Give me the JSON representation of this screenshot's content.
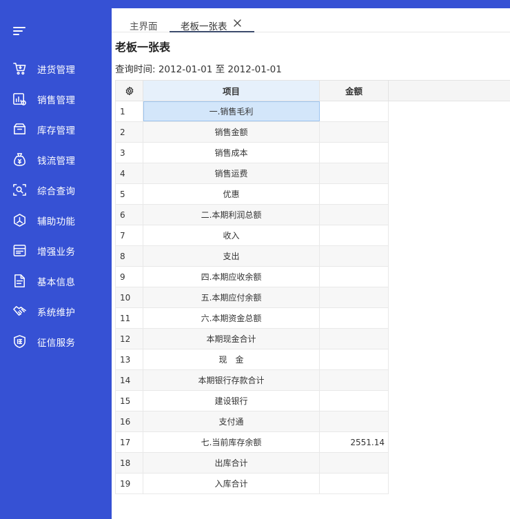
{
  "sidebar": {
    "items": [
      {
        "label": "进货管理",
        "icon": "cart-icon"
      },
      {
        "label": "销售管理",
        "icon": "sales-chart-icon"
      },
      {
        "label": "库存管理",
        "icon": "box-icon"
      },
      {
        "label": "钱流管理",
        "icon": "money-bag-icon"
      },
      {
        "label": "综合查询",
        "icon": "scan-search-icon"
      },
      {
        "label": "辅助功能",
        "icon": "hexagon-tool-icon"
      },
      {
        "label": "增强业务",
        "icon": "list-doc-icon"
      },
      {
        "label": "基本信息",
        "icon": "document-icon"
      },
      {
        "label": "系统维护",
        "icon": "handshake-icon"
      },
      {
        "label": "征信服务",
        "icon": "credit-shield-icon"
      }
    ]
  },
  "tabs": [
    {
      "label": "主界面"
    },
    {
      "label": "老板一张表"
    }
  ],
  "page": {
    "title": "老板一张表",
    "query_label": "查询时间: ",
    "date_from": "2012-01-01",
    "date_sep": " 至 ",
    "date_to": "2012-01-01"
  },
  "table": {
    "headers": {
      "item": "项目",
      "amount": "金额"
    },
    "rows": [
      {
        "num": "1",
        "item": "一.销售毛利",
        "amount": ""
      },
      {
        "num": "2",
        "item": "销售金额",
        "amount": ""
      },
      {
        "num": "3",
        "item": "销售成本",
        "amount": ""
      },
      {
        "num": "4",
        "item": "销售运费",
        "amount": ""
      },
      {
        "num": "5",
        "item": "优惠",
        "amount": ""
      },
      {
        "num": "6",
        "item": "二.本期利润总额",
        "amount": ""
      },
      {
        "num": "7",
        "item": "收入",
        "amount": ""
      },
      {
        "num": "8",
        "item": "支出",
        "amount": ""
      },
      {
        "num": "9",
        "item": "四.本期应收余额",
        "amount": ""
      },
      {
        "num": "10",
        "item": "五.本期应付余额",
        "amount": ""
      },
      {
        "num": "11",
        "item": "六.本期资金总额",
        "amount": ""
      },
      {
        "num": "12",
        "item": "本期现金合计",
        "amount": ""
      },
      {
        "num": "13",
        "item": "现　金",
        "amount": ""
      },
      {
        "num": "14",
        "item": "本期银行存款合计",
        "amount": ""
      },
      {
        "num": "15",
        "item": "建设银行",
        "amount": ""
      },
      {
        "num": "16",
        "item": "支付通",
        "amount": ""
      },
      {
        "num": "17",
        "item": "七.当前库存余额",
        "amount": "2551.14"
      },
      {
        "num": "18",
        "item": "出库合计",
        "amount": ""
      },
      {
        "num": "19",
        "item": "入库合计",
        "amount": ""
      }
    ]
  },
  "colors": {
    "sidebar_bg": "#3651d4",
    "selected_cell": "#d3e6fa",
    "header_item_bg": "#e6f0fb"
  }
}
